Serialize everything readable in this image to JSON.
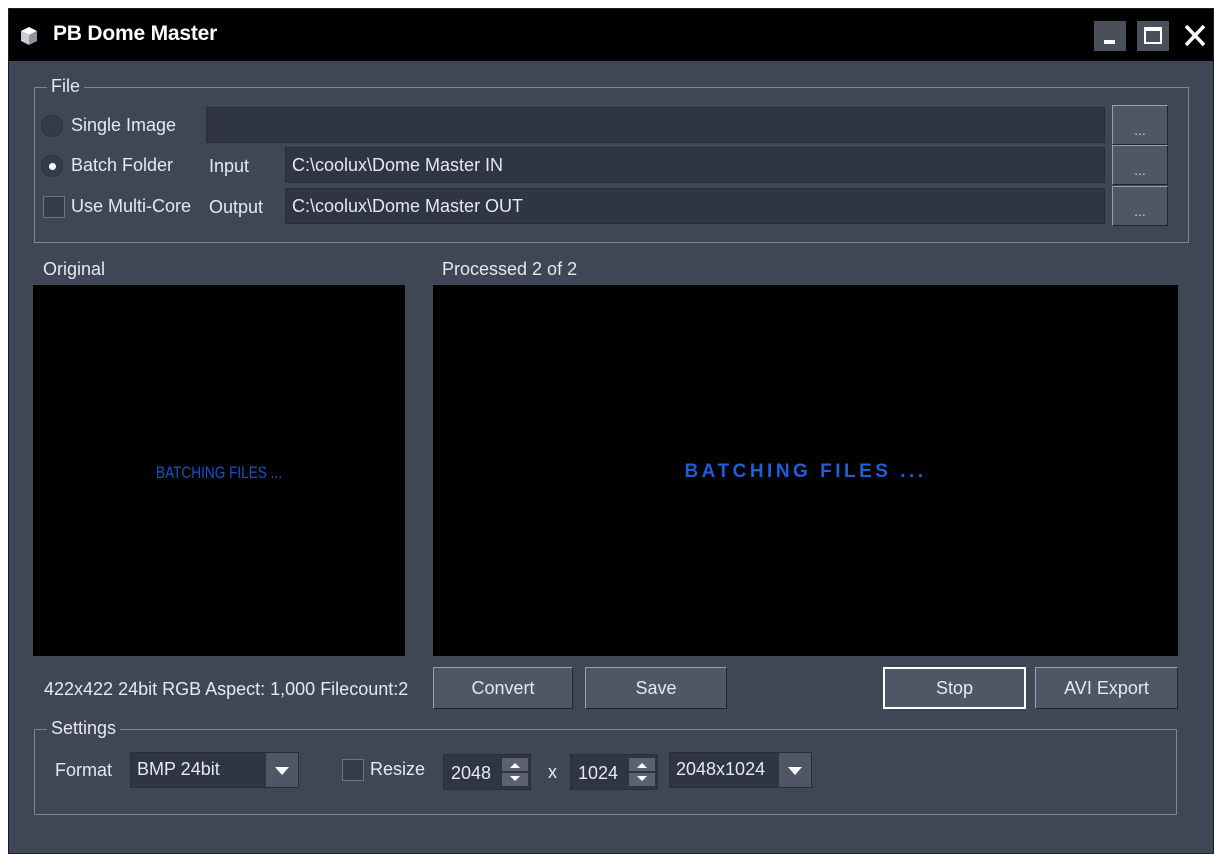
{
  "window": {
    "title": "PB Dome Master",
    "icon": "cube-icon",
    "controls": [
      "minimize-icon",
      "maximize-icon",
      "close-icon"
    ]
  },
  "file_group": {
    "legend": "File",
    "single_image_label": "Single Image",
    "single_image_selected": false,
    "single_image_value": "",
    "batch_folder_label": "Batch Folder",
    "batch_folder_selected": true,
    "input_label": "Input",
    "input_value": "C:\\coolux\\Dome Master IN",
    "use_multicore_label": "Use Multi-Core",
    "use_multicore_checked": false,
    "output_label": "Output",
    "output_value": "C:\\coolux\\Dome Master OUT",
    "browse_label": "..."
  },
  "preview": {
    "original_label": "Original",
    "processed_label": "Processed 2 of 2",
    "original_message": "BATCHING FILES ...",
    "processed_message": "BATCHING FILES ...",
    "message_color": "#1f5ed8",
    "info_text": "422x422 24bit RGB Aspect: 1,000 Filecount:2"
  },
  "actions": {
    "convert_label": "Convert",
    "save_label": "Save",
    "stop_label": "Stop",
    "avi_export_label": "AVI Export"
  },
  "settings_group": {
    "legend": "Settings",
    "format_label": "Format",
    "format_value": "BMP 24bit",
    "resize_label": "Resize",
    "resize_checked": false,
    "width_value": "2048",
    "times_label": "x",
    "height_value": "1024",
    "preset_value": "2048x1024"
  },
  "colors": {
    "window_bg": "#3f4757",
    "titlebar_bg": "#000000",
    "preview_bg": "#000000",
    "accent_blue": "#1f5ed8"
  }
}
